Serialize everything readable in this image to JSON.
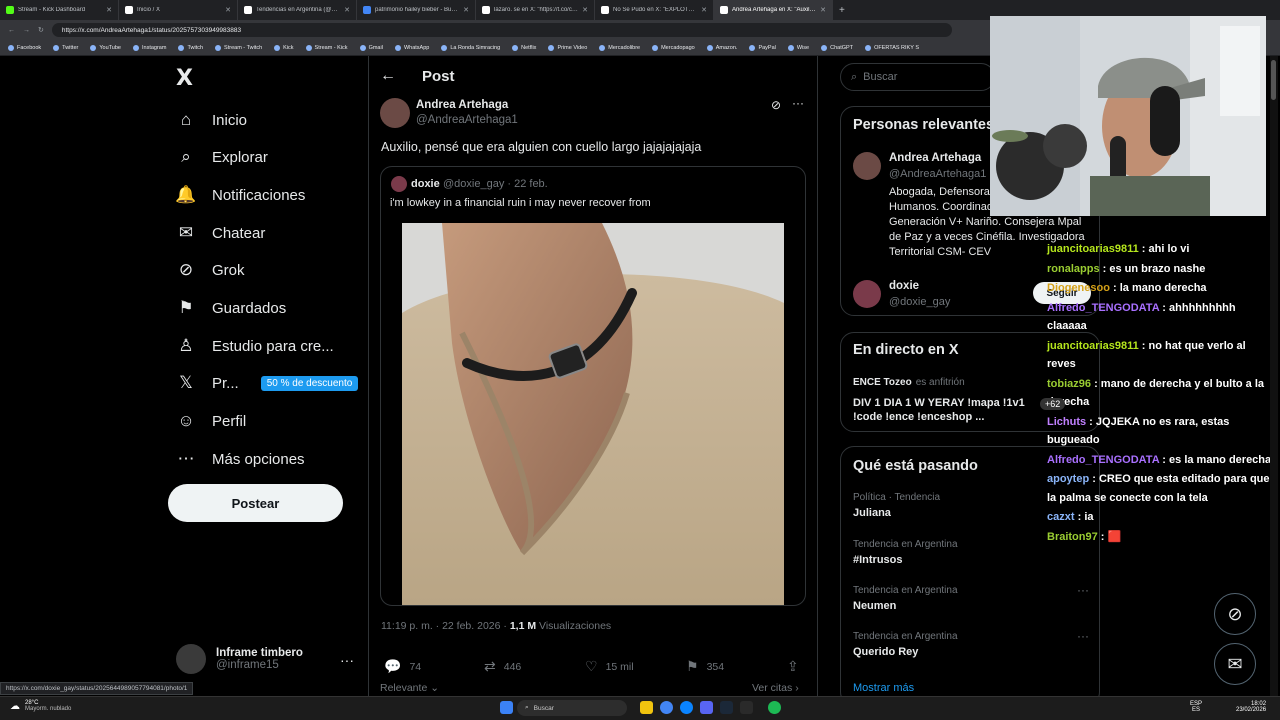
{
  "browser": {
    "tabs": [
      {
        "label": "Stream - Kick Dashboard",
        "color": "#53fc18",
        "active": false
      },
      {
        "label": "Inicio / X",
        "color": "#ffffff",
        "active": false
      },
      {
        "label": "Tendencias en Argentina (@porqu",
        "color": "#ffffff",
        "active": false
      },
      {
        "label": "patrimonio hailey bieber - Buscar",
        "color": "#4285f4",
        "active": false
      },
      {
        "label": "lázaro. se en X: \"https://t.co/cyw",
        "color": "#ffffff",
        "active": false
      },
      {
        "label": "No Se Pudo en X: \"EXPLOTÓ ERN",
        "color": "#ffffff",
        "active": false
      },
      {
        "label": "Andrea Artehaga en X: \"Auxilio, p",
        "color": "#ffffff",
        "active": true
      }
    ],
    "url": "https://x.com/AndreaArtehaga1/status/2025757303949983883",
    "bookmarks": [
      "Facebook",
      "Twitter",
      "YouTube",
      "Instagram",
      "Twitch",
      "Stream - Twitch",
      "Kick",
      "Stream - Kick",
      "Gmail",
      "WhatsApp",
      "La Ronda Simracing",
      "Netflix",
      "Prime Video",
      "Mercadolibre",
      "Mercadopago",
      "Amazon.",
      "PayPal",
      "Wise",
      "ChatGPT",
      "OFERTAS RIKY S"
    ]
  },
  "nav": {
    "logo": "X",
    "items": [
      {
        "label": "Inicio",
        "icon": "home-icon",
        "glyph": "⌂"
      },
      {
        "label": "Explorar",
        "icon": "search-icon",
        "glyph": "⌕"
      },
      {
        "label": "Notificaciones",
        "icon": "bell-icon",
        "glyph": "🔔"
      },
      {
        "label": "Chatear",
        "icon": "mail-icon",
        "glyph": "✉"
      },
      {
        "label": "Grok",
        "icon": "grok-icon",
        "glyph": "⊘"
      },
      {
        "label": "Guardados",
        "icon": "bookmark-icon",
        "glyph": "⚑"
      },
      {
        "label": "Estudio para cre...",
        "icon": "flask-icon",
        "glyph": "♙"
      },
      {
        "label": "Pr...",
        "icon": "x-premium-icon",
        "glyph": "𝕏"
      },
      {
        "label": "Perfil",
        "icon": "person-icon",
        "glyph": "☺"
      },
      {
        "label": "Más opciones",
        "icon": "more-circle-icon",
        "glyph": "⋯"
      }
    ],
    "promo": "50 % de descuento",
    "post_button": "Postear",
    "account": {
      "name": "Inframe timbero",
      "handle": "@inframe15"
    }
  },
  "post": {
    "header": "Post",
    "author": {
      "name": "Andrea Artehaga",
      "handle": "@AndreaArtehaga1"
    },
    "text": "Auxilio, pensé que era alguien con cuello largo jajajajajaja",
    "quote": {
      "name": "doxie",
      "meta": "@doxie_gay · 22 feb.",
      "text": "i'm lowkey in a financial ruin i may never recover from"
    },
    "time": "11:19 p. m. · 22 feb. 2026 ·",
    "views": "1,1 M",
    "views_label": "Visualizaciones",
    "actions": {
      "replies": "74",
      "reposts": "446",
      "likes": "15 mil",
      "bookmarks": "354"
    },
    "relevante": "Relevante",
    "ver_citas": "Ver citas"
  },
  "sidebar": {
    "search_placeholder": "Buscar",
    "relevant_title": "Personas relevantes",
    "person1": {
      "name": "Andrea Artehaga",
      "handle": "@AndreaArtehaga1",
      "bio": "Abogada, Defensora de Derechos Humanos. Coordinadora Nacional Generación V+ Nariño. Consejera Mpal de Paz y a veces Cinéfila. Investigadora Territorial CSM- CEV"
    },
    "person2": {
      "name": "doxie",
      "handle": "@doxie_gay",
      "follow": "Seguir"
    },
    "live_title": "En directo en X",
    "live": {
      "host": "ENCE Tozeo",
      "role": "es anfitrión",
      "title": "DIV 1 DIA 1 W YERAY !mapa !1v1 !code !ence !enceshop ..."
    },
    "trends_title": "Qué está pasando",
    "trends": [
      {
        "cat": "Política · Tendencia",
        "name": "Juliana"
      },
      {
        "cat": "Tendencia en Argentina",
        "name": "#Intrusos"
      },
      {
        "cat": "Tendencia en Argentina",
        "name": "Neumen"
      },
      {
        "cat": "Tendencia en Argentina",
        "name": "Querido Rey"
      }
    ],
    "show_more": "Mostrar más"
  },
  "chat": {
    "messages": [
      {
        "user": "juancitoarias9811",
        "color": "#b5e61d",
        "text": "ahi lo vi"
      },
      {
        "user": "ronalapps",
        "color": "#9acd32",
        "text": "es un brazo nashe"
      },
      {
        "user": "Diogenesoo",
        "color": "#d4a017",
        "text": "la mano derecha"
      },
      {
        "user": "Alfredo_TENGODATA",
        "color": "#a970ff",
        "text": "ahhhhhhhhh claaaaa"
      },
      {
        "user": "juancitoarias9811",
        "color": "#b5e61d",
        "text": "no hat que verlo al reves"
      },
      {
        "user": "tobiaz96",
        "color": "#9acd32",
        "text": "mano de derecha y el bulto a la derecha"
      },
      {
        "user": "Lichuts",
        "color": "#c080ff",
        "text": "JQJEKA no es rara, estas bugueado"
      },
      {
        "user": "Alfredo_TENGODATA",
        "color": "#a970ff",
        "text": "es la mano derecha"
      },
      {
        "user": "apoytep",
        "color": "#8ab4f8",
        "text": "CREO que esta editado para que la palma se conecte con la tela"
      },
      {
        "user": "cazxt",
        "color": "#8ab4f8",
        "text": "ia"
      },
      {
        "user": "Braiton97",
        "color": "#9acd32",
        "text": "🟥"
      }
    ],
    "badge": "+62"
  },
  "status_url": "https://x.com/doxie_gay/status/2025644989057794081/photo/1",
  "taskbar": {
    "weather_temp": "28°C",
    "weather_desc": "Mayorm. nublado",
    "search": "Buscar",
    "lang1": "ESP",
    "lang2": "ES",
    "time": "18:02",
    "date": "23/02/2026"
  }
}
